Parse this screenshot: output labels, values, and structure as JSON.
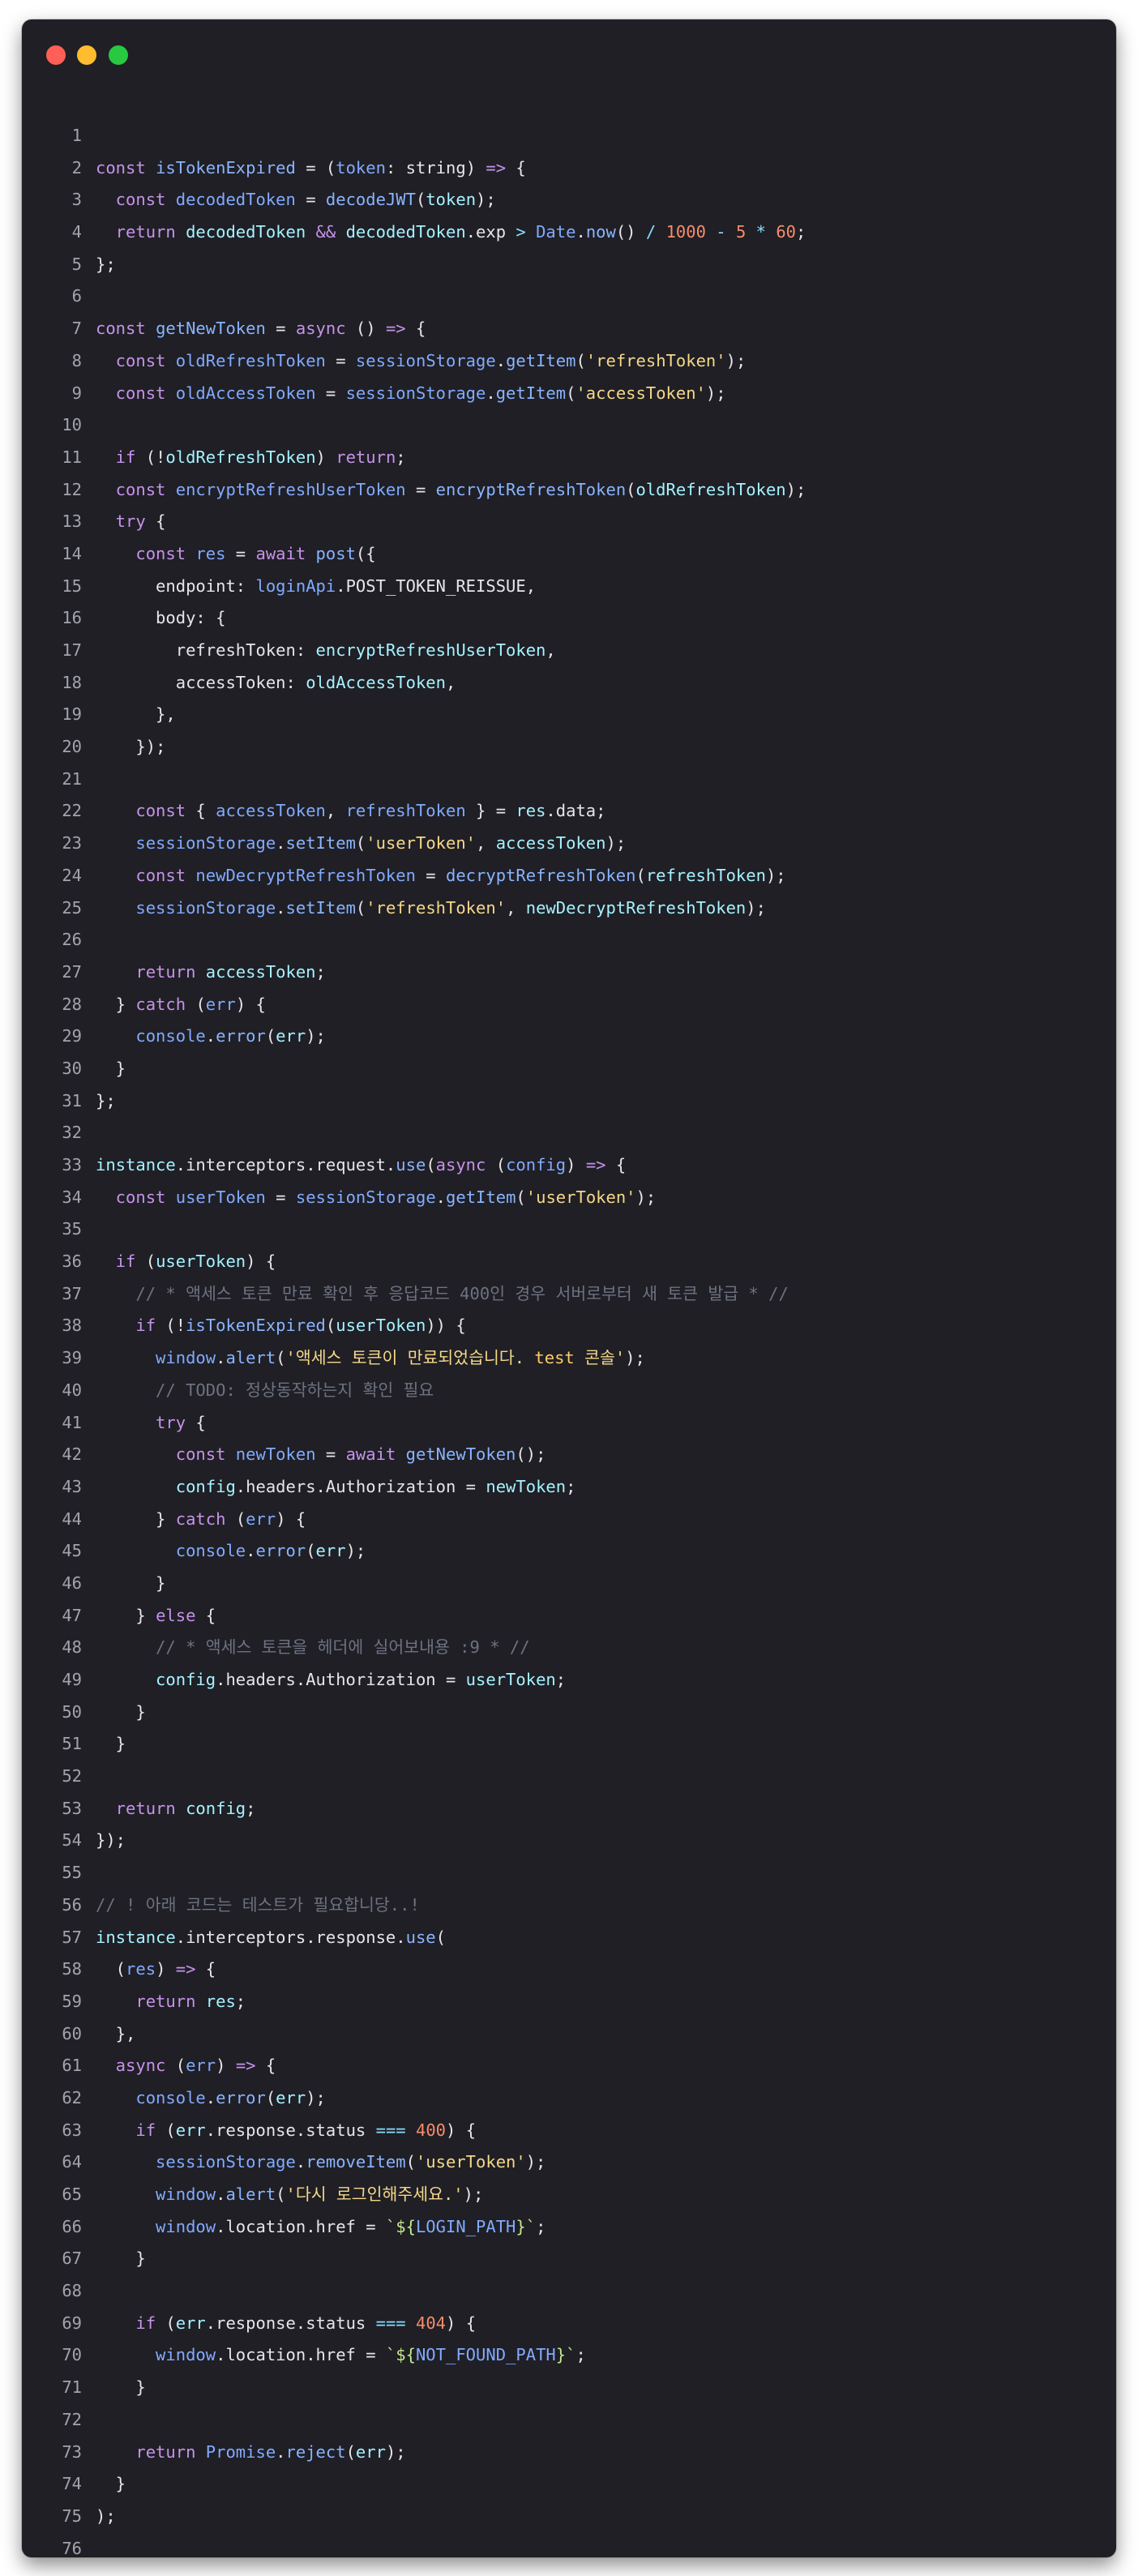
{
  "window": {
    "controls": [
      "close",
      "minimize",
      "maximize"
    ]
  },
  "code": {
    "language": "typescript",
    "lines": [
      [],
      [
        [
          "const ",
          "k"
        ],
        [
          "isTokenExpired",
          "f"
        ],
        [
          " = (",
          "p"
        ],
        [
          "token",
          "i"
        ],
        [
          ": ",
          "p"
        ],
        [
          "string",
          "p"
        ],
        [
          ") ",
          "p"
        ],
        [
          "=>",
          "k"
        ],
        [
          " {",
          "p"
        ]
      ],
      [
        [
          "  const ",
          "k"
        ],
        [
          "decodedToken",
          "i"
        ],
        [
          " = ",
          "p"
        ],
        [
          "decodeJWT",
          "f"
        ],
        [
          "(",
          "p"
        ],
        [
          "token",
          "v"
        ],
        [
          ");",
          "p"
        ]
      ],
      [
        [
          "  return ",
          "k"
        ],
        [
          "decodedToken",
          "v"
        ],
        [
          " ",
          "p"
        ],
        [
          "&&",
          "k"
        ],
        [
          " ",
          "p"
        ],
        [
          "decodedToken",
          "v"
        ],
        [
          ".exp ",
          "p"
        ],
        [
          ">",
          "o"
        ],
        [
          " ",
          "p"
        ],
        [
          "Date",
          "i"
        ],
        [
          ".",
          "p"
        ],
        [
          "now",
          "f"
        ],
        [
          "() ",
          "p"
        ],
        [
          "/",
          "o"
        ],
        [
          " ",
          "p"
        ],
        [
          "1000",
          "n"
        ],
        [
          " ",
          "p"
        ],
        [
          "-",
          "o"
        ],
        [
          " ",
          "p"
        ],
        [
          "5",
          "n"
        ],
        [
          " ",
          "p"
        ],
        [
          "*",
          "o"
        ],
        [
          " ",
          "p"
        ],
        [
          "60",
          "n"
        ],
        [
          ";",
          "p"
        ]
      ],
      [
        [
          "};",
          "p"
        ]
      ],
      [],
      [
        [
          "const ",
          "k"
        ],
        [
          "getNewToken",
          "f"
        ],
        [
          " = ",
          "p"
        ],
        [
          "async",
          "k"
        ],
        [
          " () ",
          "p"
        ],
        [
          "=>",
          "k"
        ],
        [
          " {",
          "p"
        ]
      ],
      [
        [
          "  const ",
          "k"
        ],
        [
          "oldRefreshToken",
          "i"
        ],
        [
          " = ",
          "p"
        ],
        [
          "sessionStorage",
          "i"
        ],
        [
          ".",
          "p"
        ],
        [
          "getItem",
          "f"
        ],
        [
          "(",
          "p"
        ],
        [
          "'refreshToken'",
          "s"
        ],
        [
          ");",
          "p"
        ]
      ],
      [
        [
          "  const ",
          "k"
        ],
        [
          "oldAccessToken",
          "i"
        ],
        [
          " = ",
          "p"
        ],
        [
          "sessionStorage",
          "i"
        ],
        [
          ".",
          "p"
        ],
        [
          "getItem",
          "f"
        ],
        [
          "(",
          "p"
        ],
        [
          "'accessToken'",
          "s"
        ],
        [
          ");",
          "p"
        ]
      ],
      [],
      [
        [
          "  if ",
          "k"
        ],
        [
          "(!",
          "p"
        ],
        [
          "oldRefreshToken",
          "v"
        ],
        [
          ") ",
          "p"
        ],
        [
          "return",
          "k"
        ],
        [
          ";",
          "p"
        ]
      ],
      [
        [
          "  const ",
          "k"
        ],
        [
          "encryptRefreshUserToken",
          "i"
        ],
        [
          " = ",
          "p"
        ],
        [
          "encryptRefreshToken",
          "f"
        ],
        [
          "(",
          "p"
        ],
        [
          "oldRefreshToken",
          "v"
        ],
        [
          ");",
          "p"
        ]
      ],
      [
        [
          "  try ",
          "k"
        ],
        [
          "{",
          "p"
        ]
      ],
      [
        [
          "    const ",
          "k"
        ],
        [
          "res",
          "i"
        ],
        [
          " = ",
          "p"
        ],
        [
          "await ",
          "k"
        ],
        [
          "post",
          "f"
        ],
        [
          "({",
          "p"
        ]
      ],
      [
        [
          "      endpoint",
          "p"
        ],
        [
          ": ",
          "p"
        ],
        [
          "loginApi",
          "i"
        ],
        [
          ".",
          "p"
        ],
        [
          "POST_TOKEN_REISSUE",
          "p"
        ],
        [
          ",",
          "p"
        ]
      ],
      [
        [
          "      body",
          "p"
        ],
        [
          ": {",
          "p"
        ]
      ],
      [
        [
          "        refreshToken",
          "p"
        ],
        [
          ": ",
          "p"
        ],
        [
          "encryptRefreshUserToken",
          "v"
        ],
        [
          ",",
          "p"
        ]
      ],
      [
        [
          "        accessToken",
          "p"
        ],
        [
          ": ",
          "p"
        ],
        [
          "oldAccessToken",
          "v"
        ],
        [
          ",",
          "p"
        ]
      ],
      [
        [
          "      },",
          "p"
        ]
      ],
      [
        [
          "    });",
          "p"
        ]
      ],
      [],
      [
        [
          "    const ",
          "k"
        ],
        [
          "{ ",
          "p"
        ],
        [
          "accessToken",
          "i"
        ],
        [
          ", ",
          "p"
        ],
        [
          "refreshToken",
          "i"
        ],
        [
          " } = ",
          "p"
        ],
        [
          "res",
          "v"
        ],
        [
          ".data;",
          "p"
        ]
      ],
      [
        [
          "    sessionStorage",
          "i"
        ],
        [
          ".",
          "p"
        ],
        [
          "setItem",
          "f"
        ],
        [
          "(",
          "p"
        ],
        [
          "'userToken'",
          "s"
        ],
        [
          ", ",
          "p"
        ],
        [
          "accessToken",
          "v"
        ],
        [
          ");",
          "p"
        ]
      ],
      [
        [
          "    const ",
          "k"
        ],
        [
          "newDecryptRefreshToken",
          "i"
        ],
        [
          " = ",
          "p"
        ],
        [
          "decryptRefreshToken",
          "f"
        ],
        [
          "(",
          "p"
        ],
        [
          "refreshToken",
          "v"
        ],
        [
          ");",
          "p"
        ]
      ],
      [
        [
          "    sessionStorage",
          "i"
        ],
        [
          ".",
          "p"
        ],
        [
          "setItem",
          "f"
        ],
        [
          "(",
          "p"
        ],
        [
          "'refreshToken'",
          "s"
        ],
        [
          ", ",
          "p"
        ],
        [
          "newDecryptRefreshToken",
          "v"
        ],
        [
          ");",
          "p"
        ]
      ],
      [],
      [
        [
          "    return ",
          "k"
        ],
        [
          "accessToken",
          "v"
        ],
        [
          ";",
          "p"
        ]
      ],
      [
        [
          "  } ",
          "p"
        ],
        [
          "catch ",
          "k"
        ],
        [
          "(",
          "p"
        ],
        [
          "err",
          "i"
        ],
        [
          ") {",
          "p"
        ]
      ],
      [
        [
          "    console",
          "i"
        ],
        [
          ".",
          "p"
        ],
        [
          "error",
          "f"
        ],
        [
          "(",
          "p"
        ],
        [
          "err",
          "v"
        ],
        [
          ");",
          "p"
        ]
      ],
      [
        [
          "  }",
          "p"
        ]
      ],
      [
        [
          "};",
          "p"
        ]
      ],
      [],
      [
        [
          "instance",
          "v"
        ],
        [
          ".interceptors.request.",
          "p"
        ],
        [
          "use",
          "f"
        ],
        [
          "(",
          "p"
        ],
        [
          "async ",
          "k"
        ],
        [
          "(",
          "p"
        ],
        [
          "config",
          "i"
        ],
        [
          ") ",
          "p"
        ],
        [
          "=>",
          "k"
        ],
        [
          " {",
          "p"
        ]
      ],
      [
        [
          "  const ",
          "k"
        ],
        [
          "userToken",
          "i"
        ],
        [
          " = ",
          "p"
        ],
        [
          "sessionStorage",
          "i"
        ],
        [
          ".",
          "p"
        ],
        [
          "getItem",
          "f"
        ],
        [
          "(",
          "p"
        ],
        [
          "'userToken'",
          "s"
        ],
        [
          ");",
          "p"
        ]
      ],
      [],
      [
        [
          "  if ",
          "k"
        ],
        [
          "(",
          "p"
        ],
        [
          "userToken",
          "v"
        ],
        [
          ") {",
          "p"
        ]
      ],
      [
        [
          "    // * 액세스 토큰 만료 확인 후 응답코드 400인 경우 서버로부터 새 토큰 발급 * //",
          "c"
        ]
      ],
      [
        [
          "    if ",
          "k"
        ],
        [
          "(!",
          "p"
        ],
        [
          "isTokenExpired",
          "f"
        ],
        [
          "(",
          "p"
        ],
        [
          "userToken",
          "v"
        ],
        [
          ")) {",
          "p"
        ]
      ],
      [
        [
          "      window",
          "i"
        ],
        [
          ".",
          "p"
        ],
        [
          "alert",
          "f"
        ],
        [
          "(",
          "p"
        ],
        [
          "'액세스 토큰이 만료되었습니다. ",
          "s"
        ],
        [
          "test",
          "t"
        ],
        [
          " 콘솔'",
          "s"
        ],
        [
          ");",
          "p"
        ]
      ],
      [
        [
          "      // TODO: 정상동작하는지 확인 필요",
          "c"
        ]
      ],
      [
        [
          "      try ",
          "k"
        ],
        [
          "{",
          "p"
        ]
      ],
      [
        [
          "        const ",
          "k"
        ],
        [
          "newToken",
          "i"
        ],
        [
          " = ",
          "p"
        ],
        [
          "await ",
          "k"
        ],
        [
          "getNewToken",
          "f"
        ],
        [
          "();",
          "p"
        ]
      ],
      [
        [
          "        config",
          "v"
        ],
        [
          ".headers.Authorization = ",
          "p"
        ],
        [
          "newToken",
          "v"
        ],
        [
          ";",
          "p"
        ]
      ],
      [
        [
          "      } ",
          "p"
        ],
        [
          "catch ",
          "k"
        ],
        [
          "(",
          "p"
        ],
        [
          "err",
          "i"
        ],
        [
          ") {",
          "p"
        ]
      ],
      [
        [
          "        console",
          "i"
        ],
        [
          ".",
          "p"
        ],
        [
          "error",
          "f"
        ],
        [
          "(",
          "p"
        ],
        [
          "err",
          "v"
        ],
        [
          ");",
          "p"
        ]
      ],
      [
        [
          "      }",
          "p"
        ]
      ],
      [
        [
          "    } ",
          "p"
        ],
        [
          "else ",
          "k"
        ],
        [
          "{",
          "p"
        ]
      ],
      [
        [
          "      // * 액세스 토큰을 헤더에 실어보내용 :9 * //",
          "c"
        ]
      ],
      [
        [
          "      config",
          "v"
        ],
        [
          ".headers.Authorization = ",
          "p"
        ],
        [
          "userToken",
          "v"
        ],
        [
          ";",
          "p"
        ]
      ],
      [
        [
          "    }",
          "p"
        ]
      ],
      [
        [
          "  }",
          "p"
        ]
      ],
      [],
      [
        [
          "  return ",
          "k"
        ],
        [
          "config",
          "v"
        ],
        [
          ";",
          "p"
        ]
      ],
      [
        [
          "});",
          "p"
        ]
      ],
      [],
      [
        [
          "// ! 아래 코드는 테스트가 필요합니당..!",
          "c"
        ]
      ],
      [
        [
          "instance",
          "v"
        ],
        [
          ".interceptors.response.",
          "p"
        ],
        [
          "use",
          "f"
        ],
        [
          "(",
          "p"
        ]
      ],
      [
        [
          "  (",
          "p"
        ],
        [
          "res",
          "i"
        ],
        [
          ") ",
          "p"
        ],
        [
          "=>",
          "k"
        ],
        [
          " {",
          "p"
        ]
      ],
      [
        [
          "    return ",
          "k"
        ],
        [
          "res",
          "v"
        ],
        [
          ";",
          "p"
        ]
      ],
      [
        [
          "  },",
          "p"
        ]
      ],
      [
        [
          "  async ",
          "k"
        ],
        [
          "(",
          "p"
        ],
        [
          "err",
          "i"
        ],
        [
          ") ",
          "p"
        ],
        [
          "=>",
          "k"
        ],
        [
          " {",
          "p"
        ]
      ],
      [
        [
          "    console",
          "i"
        ],
        [
          ".",
          "p"
        ],
        [
          "error",
          "f"
        ],
        [
          "(",
          "p"
        ],
        [
          "err",
          "v"
        ],
        [
          ");",
          "p"
        ]
      ],
      [
        [
          "    if ",
          "k"
        ],
        [
          "(",
          "p"
        ],
        [
          "err",
          "v"
        ],
        [
          ".response.status ",
          "p"
        ],
        [
          "===",
          "o"
        ],
        [
          " ",
          "p"
        ],
        [
          "400",
          "n"
        ],
        [
          ") {",
          "p"
        ]
      ],
      [
        [
          "      sessionStorage",
          "i"
        ],
        [
          ".",
          "p"
        ],
        [
          "removeItem",
          "f"
        ],
        [
          "(",
          "p"
        ],
        [
          "'userToken'",
          "s"
        ],
        [
          ");",
          "p"
        ]
      ],
      [
        [
          "      window",
          "i"
        ],
        [
          ".",
          "p"
        ],
        [
          "alert",
          "f"
        ],
        [
          "(",
          "p"
        ],
        [
          "'다시 로그인해주세요.'",
          "s"
        ],
        [
          ");",
          "p"
        ]
      ],
      [
        [
          "      window",
          "i"
        ],
        [
          ".location.href = ",
          "p"
        ],
        [
          "`${",
          "y"
        ],
        [
          "LOGIN_PATH",
          "i"
        ],
        [
          "}`",
          "y"
        ],
        [
          ";",
          "p"
        ]
      ],
      [
        [
          "    }",
          "p"
        ]
      ],
      [],
      [
        [
          "    if ",
          "k"
        ],
        [
          "(",
          "p"
        ],
        [
          "err",
          "v"
        ],
        [
          ".response.status ",
          "p"
        ],
        [
          "===",
          "o"
        ],
        [
          " ",
          "p"
        ],
        [
          "404",
          "n"
        ],
        [
          ") {",
          "p"
        ]
      ],
      [
        [
          "      window",
          "i"
        ],
        [
          ".location.href = ",
          "p"
        ],
        [
          "`${",
          "y"
        ],
        [
          "NOT_FOUND_PATH",
          "i"
        ],
        [
          "}`",
          "y"
        ],
        [
          ";",
          "p"
        ]
      ],
      [
        [
          "    }",
          "p"
        ]
      ],
      [],
      [
        [
          "    return ",
          "k"
        ],
        [
          "Promise",
          "i"
        ],
        [
          ".",
          "p"
        ],
        [
          "reject",
          "f"
        ],
        [
          "(",
          "p"
        ],
        [
          "err",
          "v"
        ],
        [
          ");",
          "p"
        ]
      ],
      [
        [
          "  }",
          "p"
        ]
      ],
      [
        [
          ");",
          "p"
        ]
      ],
      []
    ]
  }
}
